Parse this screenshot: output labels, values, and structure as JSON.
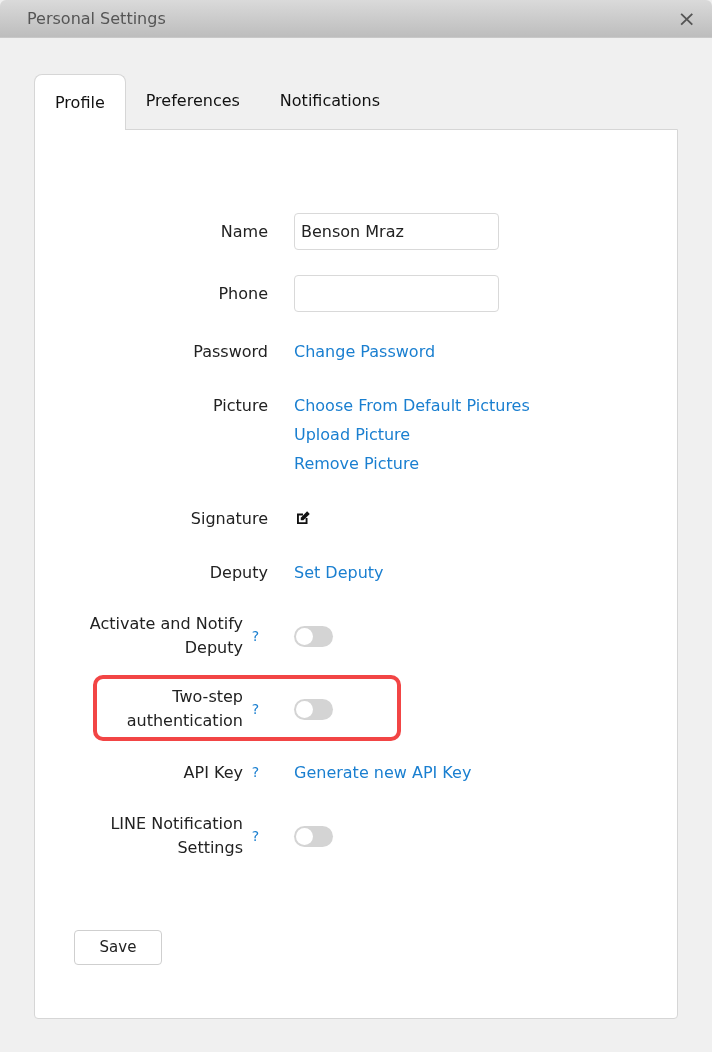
{
  "window": {
    "title": "Personal Settings",
    "close": "×"
  },
  "tabs": [
    {
      "label": "Profile",
      "selected": true
    },
    {
      "label": "Preferences",
      "selected": false
    },
    {
      "label": "Notifications",
      "selected": false
    }
  ],
  "rows": [
    {
      "kind": "field",
      "label": "Name",
      "value": "Benson Mraz"
    },
    {
      "kind": "field",
      "label": "Phone"
    },
    {
      "kind": "links",
      "label": "Password",
      "links": [
        "Change Password"
      ]
    },
    {
      "kind": "links",
      "label": "Picture",
      "links": [
        "Choose From Default Pictures",
        "Upload Picture",
        "Remove Picture"
      ]
    },
    {
      "kind": "edit",
      "label": "Signature"
    },
    {
      "kind": "links",
      "label": "Deputy",
      "links": [
        "Set Deputy"
      ]
    },
    {
      "kind": "toggle",
      "label": "Activate and Notify Deputy",
      "help": "?",
      "on": false,
      "highlighted": false
    },
    {
      "kind": "toggle",
      "label": "Two-step authentication",
      "help": "?",
      "on": false,
      "highlighted": true
    },
    {
      "kind": "links",
      "label": "API Key",
      "help": "?",
      "links": [
        "Generate new API Key"
      ]
    },
    {
      "kind": "toggle",
      "label": "LINE Notification Settings",
      "help": "?",
      "on": false,
      "highlighted": false
    }
  ],
  "save_button": "Save"
}
